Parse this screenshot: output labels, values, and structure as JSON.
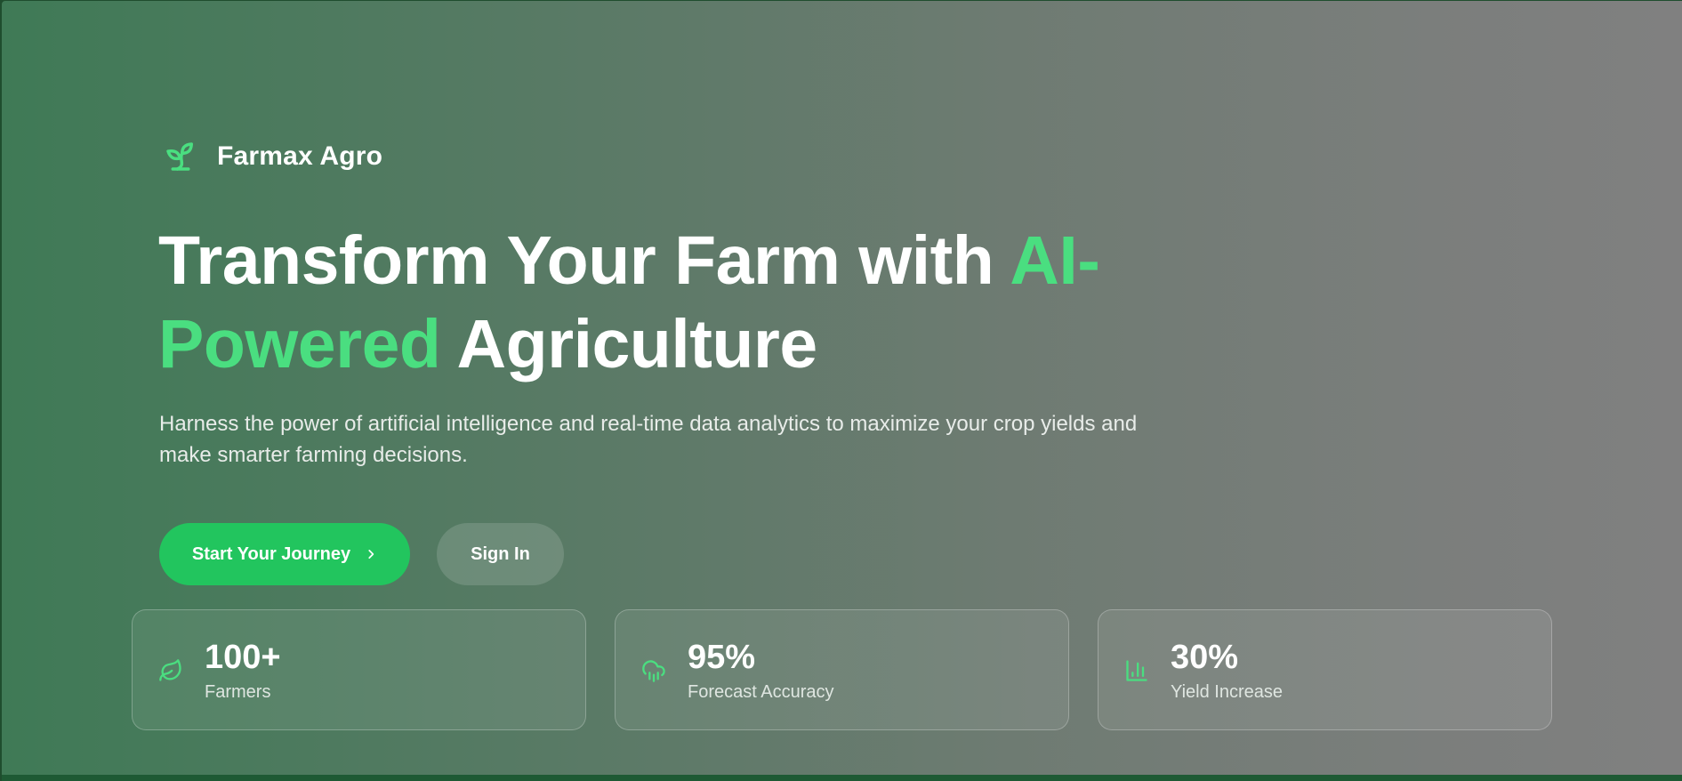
{
  "brand": {
    "name": "Farmax Agro",
    "icon": "sprout-icon"
  },
  "hero": {
    "headline_part1": "Transform Your Farm with ",
    "headline_accent": "AI-Powered",
    "headline_part2": " Agriculture",
    "subtitle": "Harness the power of artificial intelligence and real-time data analytics to maximize your crop yields and make smarter farming decisions."
  },
  "actions": {
    "primary_label": "Start Your Journey",
    "secondary_label": "Sign In"
  },
  "stats": [
    {
      "value": "100+",
      "label": "Farmers",
      "icon": "leaf-icon"
    },
    {
      "value": "95%",
      "label": "Forecast Accuracy",
      "icon": "cloud-rain-icon"
    },
    {
      "value": "30%",
      "label": "Yield Increase",
      "icon": "bar-chart-icon"
    }
  ],
  "colors": {
    "accent": "#4ade80",
    "primary_button": "#22c55e",
    "gradient_start": "#3f7a56",
    "gradient_end": "#808080"
  }
}
